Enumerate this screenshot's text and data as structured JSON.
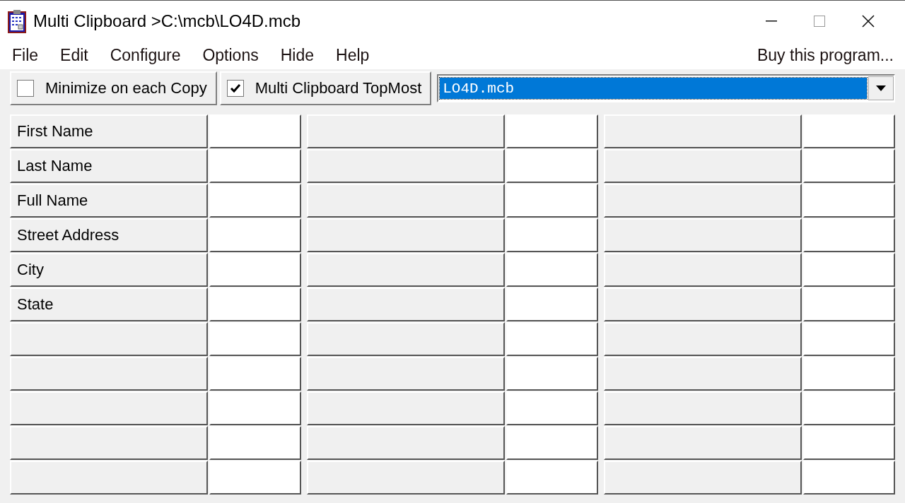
{
  "window": {
    "title": "Multi Clipboard >C:\\mcb\\LO4D.mcb"
  },
  "menu": [
    {
      "label": "File"
    },
    {
      "label": "Edit"
    },
    {
      "label": "Configure"
    },
    {
      "label": "Options"
    },
    {
      "label": "Hide"
    },
    {
      "label": "Help"
    }
  ],
  "buy_link": "Buy this program...",
  "toolbar": {
    "checkboxes": [
      {
        "label": "Minimize on each Copy",
        "checked": false
      },
      {
        "label": "Multi Clipboard TopMost",
        "checked": true
      }
    ],
    "file_combo": {
      "value": "LO4D.mcb"
    }
  },
  "groups": [
    {
      "slots": [
        {
          "kind": "labeled",
          "label": "First Name"
        },
        {
          "kind": "labeled",
          "label": "Last Name"
        },
        {
          "kind": "labeled",
          "label": "Full Name"
        },
        {
          "kind": "labeled",
          "label": "Street Address"
        },
        {
          "kind": "labeled",
          "label": "City"
        },
        {
          "kind": "labeled",
          "label": "State"
        },
        {
          "kind": "blank"
        },
        {
          "kind": "blank"
        },
        {
          "kind": "blank"
        },
        {
          "kind": "blank"
        },
        {
          "kind": "blank"
        }
      ]
    },
    {
      "slots": [
        {
          "kind": "blank"
        },
        {
          "kind": "blank"
        },
        {
          "kind": "blank"
        },
        {
          "kind": "blank"
        },
        {
          "kind": "blank"
        },
        {
          "kind": "blank"
        },
        {
          "kind": "blank"
        },
        {
          "kind": "blank"
        },
        {
          "kind": "blank"
        },
        {
          "kind": "blank"
        },
        {
          "kind": "blank"
        }
      ]
    },
    {
      "slots": [
        {
          "kind": "blank"
        },
        {
          "kind": "blank"
        },
        {
          "kind": "blank"
        },
        {
          "kind": "blank"
        },
        {
          "kind": "blank"
        },
        {
          "kind": "blank"
        },
        {
          "kind": "blank"
        },
        {
          "kind": "blank"
        },
        {
          "kind": "blank"
        },
        {
          "kind": "blank"
        },
        {
          "kind": "blank"
        }
      ]
    }
  ]
}
